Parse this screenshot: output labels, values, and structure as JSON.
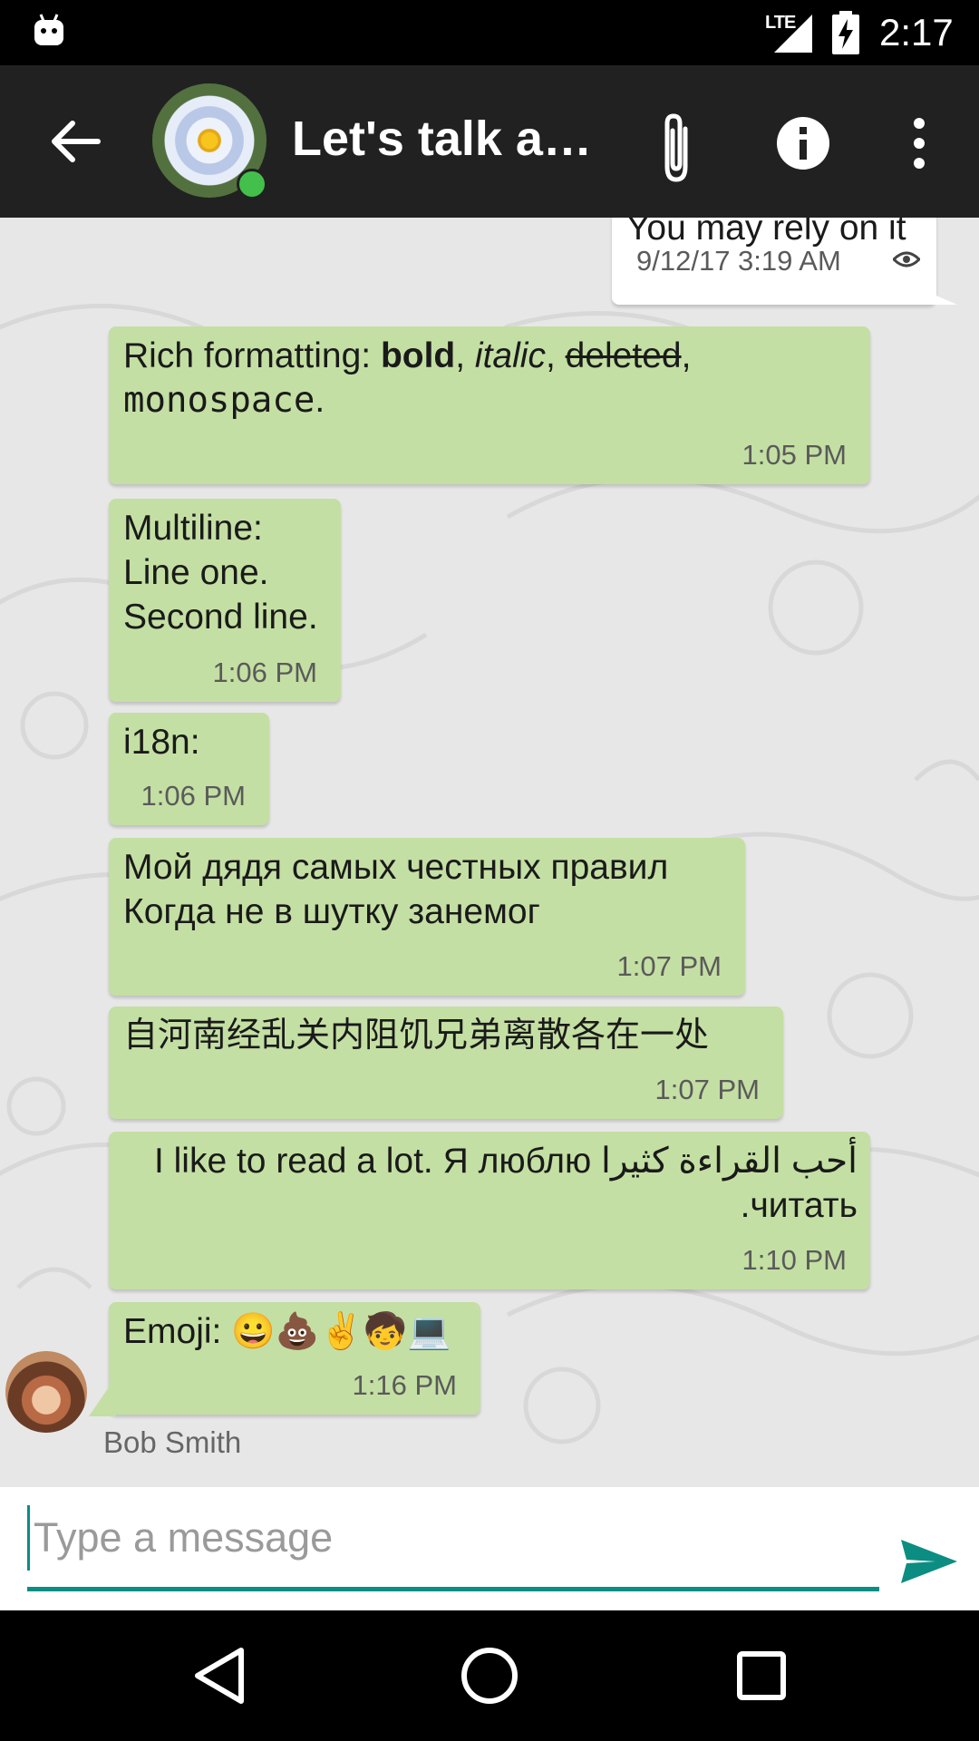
{
  "status_bar": {
    "network": "LTE",
    "time": "2:17"
  },
  "toolbar": {
    "title": "Let's talk a…"
  },
  "outgoing_partial": {
    "text": "You may rely on it",
    "time": "9/12/17 3:19 AM"
  },
  "messages": [
    {
      "id": "rich",
      "prefix": "Rich formatting: ",
      "bold": "bold",
      "sep1": ", ",
      "italic": "italic",
      "sep2": ", ",
      "deleted": "deleted",
      "sep3": ",",
      "mono": "monospace",
      "end": ".",
      "time": "1:05 PM"
    },
    {
      "id": "multiline",
      "lines": [
        "Multiline:",
        "Line one.",
        "Second line."
      ],
      "time": "1:06 PM"
    },
    {
      "id": "i18n",
      "text": "i18n:",
      "time": "1:06 PM"
    },
    {
      "id": "russian",
      "lines": [
        "Мой дядя самых честных правил",
        "Когда не в шутку занемог"
      ],
      "time": "1:07 PM"
    },
    {
      "id": "chinese",
      "text": "自河南经乱关内阻饥兄弟离散各在一处",
      "time": "1:07 PM"
    },
    {
      "id": "mixed",
      "line1": "I like to read a lot. Я люблю أحب القراءة كثيرا",
      "line2": ".читать",
      "time": "1:10 PM"
    },
    {
      "id": "emoji",
      "text": "Emoji: 😀💩✌🧒💻",
      "time": "1:16 PM"
    }
  ],
  "sender": {
    "name": "Bob Smith"
  },
  "composer": {
    "placeholder": "Type a message"
  },
  "colors": {
    "incoming_bubble": "#c4dfa3",
    "accent": "#0c8d82",
    "toolbar": "#212121",
    "chat_background": "#e7e7e7",
    "online": "#43c04b"
  }
}
